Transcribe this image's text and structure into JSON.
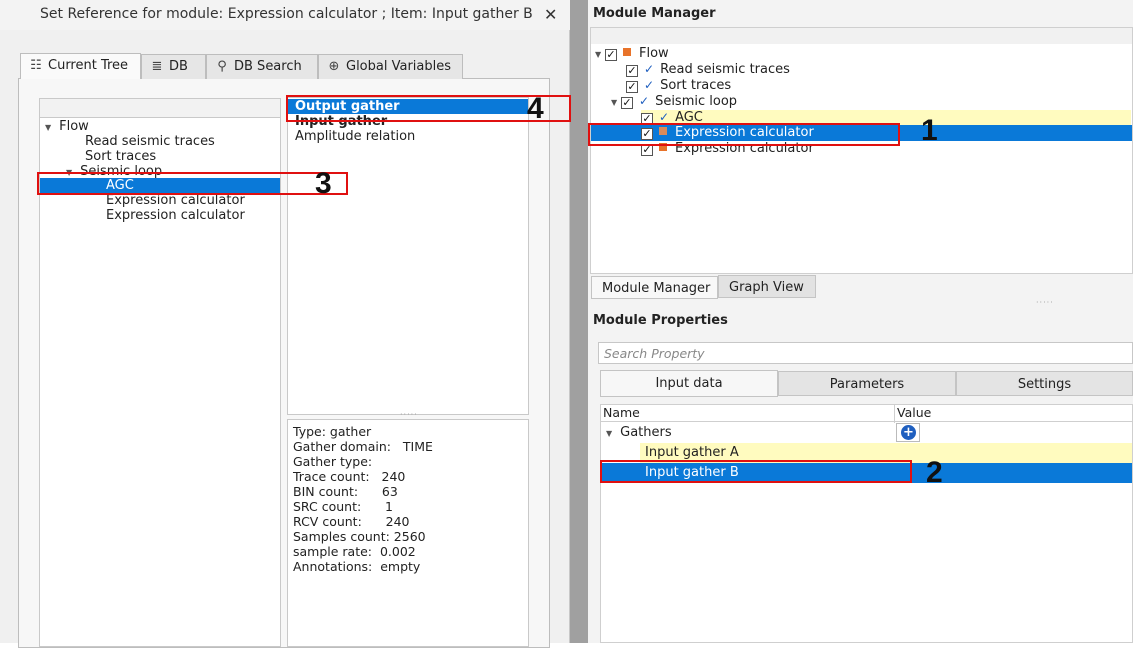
{
  "dialog": {
    "title": "Set Reference for module: Expression calculator ; Item: Input gather B",
    "close_glyph": "✕",
    "tabs": [
      {
        "label": "Current Tree",
        "icon": "tree-icon"
      },
      {
        "label": "DB",
        "icon": "database-icon"
      },
      {
        "label": "DB Search",
        "icon": "search-icon"
      },
      {
        "label": "Global Variables",
        "icon": "globe-icon"
      }
    ],
    "tree": {
      "root": "Flow",
      "items": [
        "Read seismic traces",
        "Sort traces"
      ],
      "loop": "Seismic loop",
      "loop_items": [
        "AGC",
        "Expression calculator",
        "Expression calculator"
      ]
    },
    "outputs": [
      "Output gather",
      "Input gather",
      "Amplitude relation"
    ],
    "info": [
      "Type: gather",
      "Gather domain:   TIME",
      "Gather type:",
      "Trace count:   240",
      "BIN count:      63",
      "SRC count:      1",
      "RCV count:      240",
      "Samples count: 2560",
      "sample rate:  0.002",
      "Annotations:  empty"
    ]
  },
  "module_manager": {
    "title": "Module Manager",
    "tree": {
      "root": "Flow",
      "items": [
        "Read seismic traces",
        "Sort traces"
      ],
      "loop": "Seismic loop",
      "loop_items": [
        "AGC",
        "Expression calculator",
        "Expression calculator"
      ]
    },
    "bottom_tabs": [
      "Module Manager",
      "Graph View"
    ]
  },
  "module_properties": {
    "title": "Module Properties",
    "search_placeholder": "Search Property",
    "tabs": [
      "Input data",
      "Parameters",
      "Settings"
    ],
    "columns": [
      "Name",
      "Value"
    ],
    "group": "Gathers",
    "items": [
      "Input gather A",
      "Input gather B"
    ]
  },
  "callouts": [
    "1",
    "2",
    "3",
    "4"
  ],
  "colors": {
    "selection": "#0a79d8",
    "highlight": "#fffbbf",
    "annotation": "#e01010",
    "module_icon": "#e8732a"
  }
}
